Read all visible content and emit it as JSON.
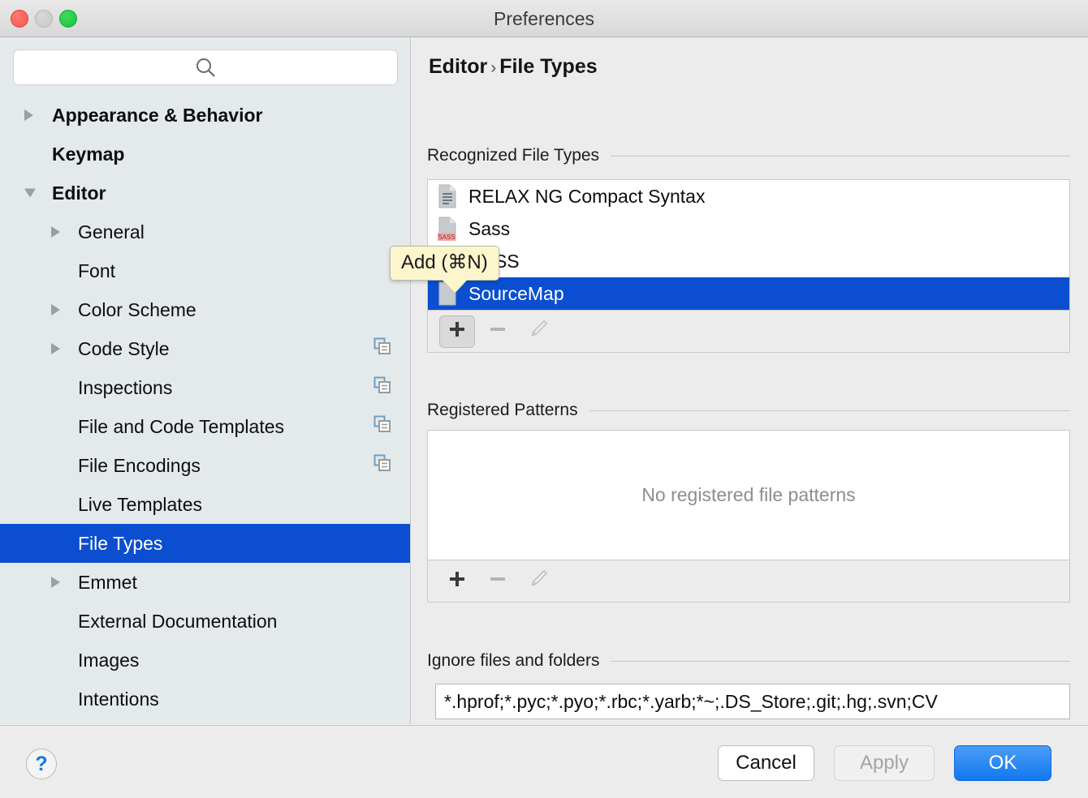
{
  "window": {
    "title": "Preferences",
    "traffic_lights": [
      "close-button",
      "minimize-button",
      "zoom-button"
    ]
  },
  "search": {
    "value": "",
    "placeholder": "",
    "icon": "search-icon"
  },
  "sidebar": {
    "items": [
      {
        "label": "Appearance & Behavior",
        "level": 0,
        "arrow": "right",
        "selected": false,
        "copy_icon": false
      },
      {
        "label": "Keymap",
        "level": 0,
        "arrow": "none",
        "selected": false,
        "copy_icon": false
      },
      {
        "label": "Editor",
        "level": 0,
        "arrow": "down",
        "selected": false,
        "copy_icon": false
      },
      {
        "label": "General",
        "level": 1,
        "arrow": "right",
        "selected": false,
        "copy_icon": false
      },
      {
        "label": "Font",
        "level": 1,
        "arrow": "none",
        "selected": false,
        "copy_icon": false
      },
      {
        "label": "Color Scheme",
        "level": 1,
        "arrow": "right",
        "selected": false,
        "copy_icon": false
      },
      {
        "label": "Code Style",
        "level": 1,
        "arrow": "right",
        "selected": false,
        "copy_icon": true
      },
      {
        "label": "Inspections",
        "level": 1,
        "arrow": "none",
        "selected": false,
        "copy_icon": true
      },
      {
        "label": "File and Code Templates",
        "level": 1,
        "arrow": "none",
        "selected": false,
        "copy_icon": true
      },
      {
        "label": "File Encodings",
        "level": 1,
        "arrow": "none",
        "selected": false,
        "copy_icon": true
      },
      {
        "label": "Live Templates",
        "level": 1,
        "arrow": "none",
        "selected": false,
        "copy_icon": false
      },
      {
        "label": "File Types",
        "level": 1,
        "arrow": "none",
        "selected": true,
        "copy_icon": false
      },
      {
        "label": "Emmet",
        "level": 1,
        "arrow": "right",
        "selected": false,
        "copy_icon": false
      },
      {
        "label": "External Documentation",
        "level": 1,
        "arrow": "none",
        "selected": false,
        "copy_icon": false
      },
      {
        "label": "Images",
        "level": 1,
        "arrow": "none",
        "selected": false,
        "copy_icon": false
      },
      {
        "label": "Intentions",
        "level": 1,
        "arrow": "none",
        "selected": false,
        "copy_icon": false
      }
    ]
  },
  "main": {
    "breadcrumb": {
      "parent": "Editor",
      "separator": "›",
      "current": "File Types"
    },
    "recognized": {
      "title": "Recognized File Types",
      "rows": [
        {
          "label": "RELAX NG Compact Syntax",
          "icon": "file-text-icon",
          "badge": "",
          "selected": false
        },
        {
          "label": "Sass",
          "icon": "file-sass-icon",
          "badge": "SASS",
          "selected": false
        },
        {
          "label": "SCSS",
          "icon": "file-sass-icon",
          "badge": "SASS",
          "selected": false
        },
        {
          "label": "SourceMap",
          "icon": "file-icon",
          "badge": "",
          "selected": true
        }
      ],
      "toolbar": [
        {
          "icon": "plus-icon",
          "enabled": true,
          "hover": true
        },
        {
          "icon": "minus-icon",
          "enabled": false,
          "hover": false
        },
        {
          "icon": "pencil-icon",
          "enabled": false,
          "hover": false
        }
      ]
    },
    "patterns": {
      "title": "Registered Patterns",
      "empty_text": "No registered file patterns",
      "toolbar": [
        {
          "icon": "plus-icon",
          "enabled": true,
          "hover": false
        },
        {
          "icon": "minus-icon",
          "enabled": false,
          "hover": false
        },
        {
          "icon": "pencil-icon",
          "enabled": false,
          "hover": false
        }
      ]
    },
    "ignore": {
      "title": "Ignore files and folders",
      "value": "*.hprof;*.pyc;*.pyo;*.rbc;*.yarb;*~;.DS_Store;.git;.hg;.svn;CV"
    }
  },
  "tooltip": {
    "text": "Add (⌘N)"
  },
  "footer": {
    "help_label": "?",
    "cancel_label": "Cancel",
    "apply_label": "Apply",
    "ok_label": "OK"
  },
  "colors": {
    "selection_blue": "#0b4fd0",
    "default_button_blue": "#1278f0",
    "sidebar_bg": "#e4e9ec",
    "panel_bg": "#ececec",
    "tooltip_bg": "#fdf6cd",
    "sass_badge": "#f3a9a9"
  }
}
